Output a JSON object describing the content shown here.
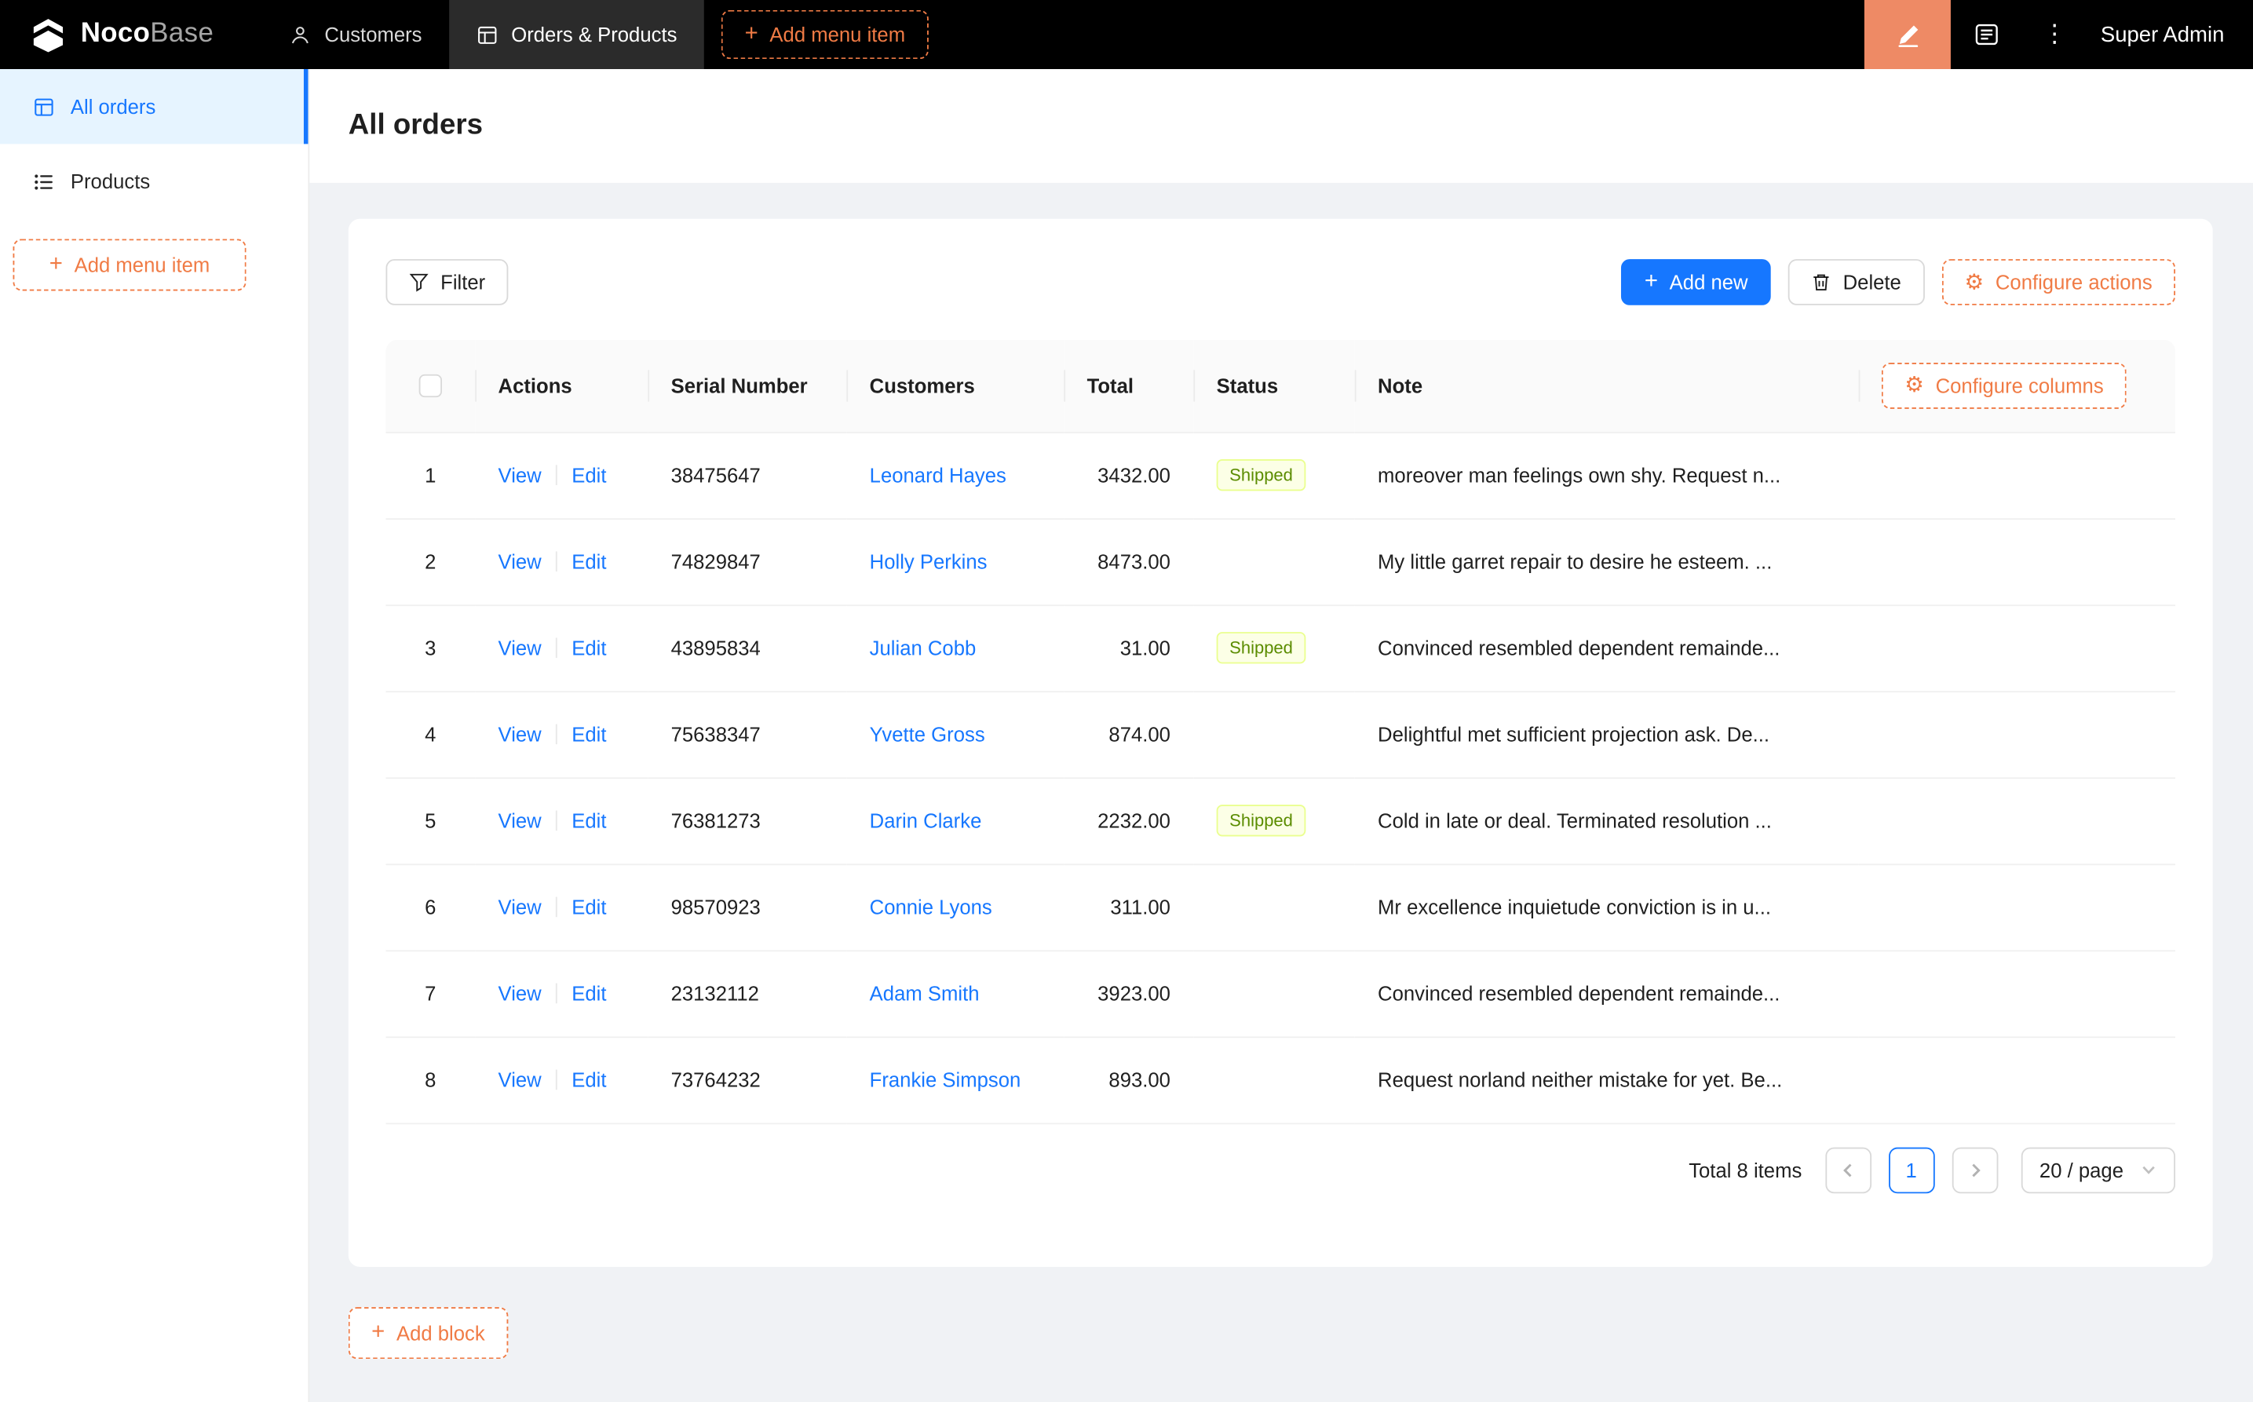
{
  "colors": {
    "primary": "#1677ff",
    "accent_orange": "#f07b45",
    "designer_salmon": "#ee8a65",
    "header_bg": "#000000",
    "active_nav_bg": "#2b2b2b",
    "sidebar_active_bg": "#e6f4ff",
    "body_bg": "#f0f2f5",
    "tag_bg": "#fcffe6",
    "tag_border": "#eaff8f",
    "tag_text": "#5b8c00"
  },
  "header": {
    "logo": {
      "bold": "Noco",
      "light": "Base"
    },
    "nav": [
      {
        "label": "Customers"
      },
      {
        "label": "Orders & Products"
      }
    ],
    "add_menu_item": "Add menu item",
    "user": "Super Admin"
  },
  "sidebar": {
    "items": [
      {
        "label": "All orders"
      },
      {
        "label": "Products"
      }
    ],
    "add_menu_item": "Add menu item"
  },
  "page": {
    "title": "All orders"
  },
  "toolbar": {
    "filter": "Filter",
    "add_new": "Add new",
    "delete": "Delete",
    "configure_actions": "Configure actions"
  },
  "table": {
    "configure_columns": "Configure columns",
    "columns": [
      "Actions",
      "Serial Number",
      "Customers",
      "Total",
      "Status",
      "Note"
    ],
    "action_view": "View",
    "action_edit": "Edit",
    "rows": [
      {
        "index": "1",
        "serial": "38475647",
        "customer": "Leonard Hayes",
        "total": "3432.00",
        "status": "Shipped",
        "note": "moreover man feelings own shy. Request n..."
      },
      {
        "index": "2",
        "serial": "74829847",
        "customer": "Holly Perkins",
        "total": "8473.00",
        "status": "",
        "note": "My little garret repair to desire he esteem. ..."
      },
      {
        "index": "3",
        "serial": "43895834",
        "customer": "Julian Cobb",
        "total": "31.00",
        "status": "Shipped",
        "note": "Convinced resembled dependent remainde..."
      },
      {
        "index": "4",
        "serial": "75638347",
        "customer": "Yvette Gross",
        "total": "874.00",
        "status": "",
        "note": "Delightful met sufficient projection ask. De..."
      },
      {
        "index": "5",
        "serial": "76381273",
        "customer": "Darin Clarke",
        "total": "2232.00",
        "status": "Shipped",
        "note": "Cold in late or deal. Terminated resolution ..."
      },
      {
        "index": "6",
        "serial": "98570923",
        "customer": "Connie Lyons",
        "total": "311.00",
        "status": "",
        "note": "Mr excellence inquietude conviction is in u..."
      },
      {
        "index": "7",
        "serial": "23132112",
        "customer": "Adam Smith",
        "total": "3923.00",
        "status": "",
        "note": "Convinced resembled dependent remainde..."
      },
      {
        "index": "8",
        "serial": "73764232",
        "customer": "Frankie Simpson",
        "total": "893.00",
        "status": "",
        "note": "Request norland neither mistake for yet. Be..."
      }
    ]
  },
  "pagination": {
    "total": "Total 8 items",
    "page": "1",
    "page_size": "20 / page"
  },
  "footer": {
    "add_block": "Add block"
  }
}
